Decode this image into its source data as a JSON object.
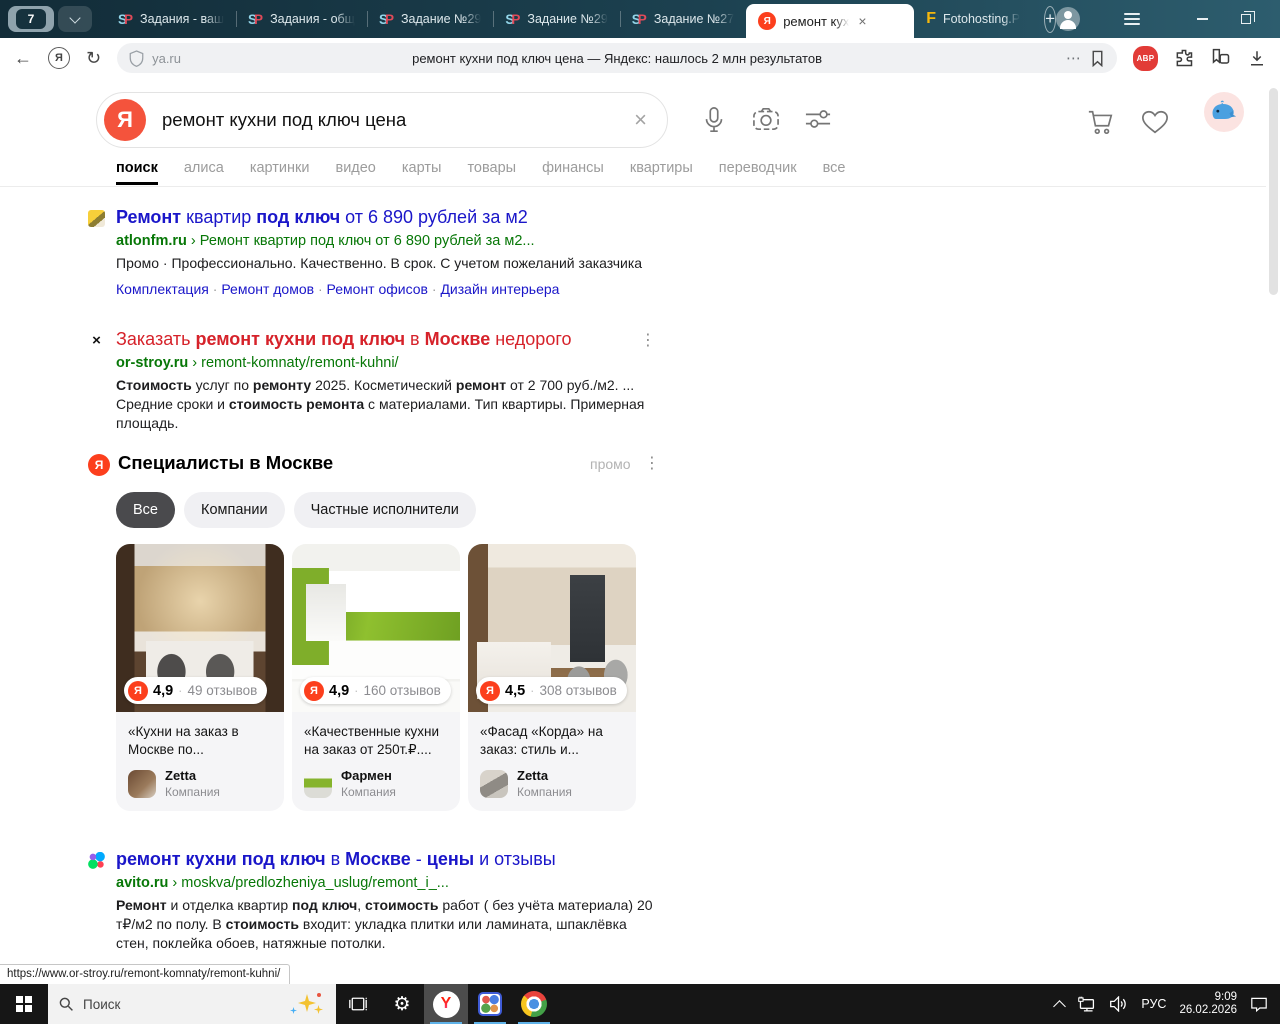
{
  "icons": {
    "close": "×",
    "clear": "×",
    "plus": "+",
    "kebab": "⋮",
    "more": "⋯",
    "back": "←",
    "refresh": "↻",
    "breadcrumb_sep": "›",
    "dot_sep": "·",
    "gear": "⚙",
    "orstroy_favicon": "×"
  },
  "browser": {
    "tab_group": {
      "count": "7"
    },
    "tabs": [
      {
        "label": "Задания - ваш",
        "icon": "sp",
        "active": false
      },
      {
        "label": "Задания - общ",
        "icon": "sp",
        "active": false
      },
      {
        "label": "Задание №29",
        "icon": "sp",
        "active": false
      },
      {
        "label": "Задание №29",
        "icon": "sp",
        "active": false
      },
      {
        "label": "Задание №27",
        "icon": "sp",
        "active": false
      },
      {
        "label": "ремонт кух",
        "icon": "yandex",
        "active": true
      },
      {
        "label": "Fotohosting.P",
        "icon": "fotohosting",
        "active": false
      }
    ],
    "toolbar": {
      "url": "ya.ru",
      "page_title": "ремонт кухни под ключ цена — Яндекс: нашлось 2 млн результатов",
      "adblock_label": "ABP"
    }
  },
  "search": {
    "logo_letter": "Я",
    "query": "ремонт кухни под ключ цена",
    "tabs": [
      {
        "label": "поиск",
        "active": true
      },
      {
        "label": "алиса",
        "active": false
      },
      {
        "label": "картинки",
        "active": false
      },
      {
        "label": "видео",
        "active": false
      },
      {
        "label": "карты",
        "active": false
      },
      {
        "label": "товары",
        "active": false
      },
      {
        "label": "финансы",
        "active": false
      },
      {
        "label": "квартиры",
        "active": false
      },
      {
        "label": "переводчик",
        "active": false
      },
      {
        "label": "все",
        "active": false
      }
    ]
  },
  "results": [
    {
      "favicon": "atlon",
      "title_color": "blue",
      "kebab": false,
      "title": [
        [
          "Ремонт",
          true
        ],
        [
          " квартир ",
          false
        ],
        [
          "под ключ",
          true
        ],
        [
          " от 6 890 рублей за м2",
          false
        ]
      ],
      "domain": "atlonfm.ru",
      "path": "Ремонт квартир под ключ от 6 890 рублей за м2...",
      "snippet": [
        [
          "Промо · Профессионально. Качественно. В срок. С учетом пожеланий заказчика",
          false
        ]
      ],
      "sitelinks": [
        "Комплектация",
        "Ремонт домов",
        "Ремонт офисов",
        "Дизайн интерьера"
      ]
    },
    {
      "favicon": "orstroy",
      "title_color": "red",
      "kebab": true,
      "title": [
        [
          "Заказать ",
          false
        ],
        [
          "ремонт кухни под ключ",
          true
        ],
        [
          " в ",
          false
        ],
        [
          "Москве",
          true
        ],
        [
          " недорого",
          false
        ]
      ],
      "domain": "or-stroy.ru",
      "path": "remont-komnaty/remont-kuhni/",
      "snippet": [
        [
          "Стоимость",
          true
        ],
        [
          " услуг по ",
          false
        ],
        [
          "ремонту",
          true
        ],
        [
          " 2025. Косметический ",
          false
        ],
        [
          "ремонт",
          true
        ],
        [
          " от 2 700 руб./м2. ... Средние сроки и ",
          false
        ],
        [
          "стоимость ремонта",
          true
        ],
        [
          " с материалами. Тип квартиры. Примерная площадь.",
          false
        ]
      ],
      "sitelinks": null
    },
    {
      "favicon": "avito",
      "title_color": "blue",
      "kebab": false,
      "title": [
        [
          "ремонт кухни под ключ",
          true
        ],
        [
          " в ",
          false
        ],
        [
          "Москве",
          true
        ],
        [
          " - ",
          false
        ],
        [
          "цены",
          true
        ],
        [
          " и отзывы",
          false
        ]
      ],
      "domain": "avito.ru",
      "path": "moskva/predlozheniya_uslug/remont_i_...",
      "snippet": [
        [
          "Ремонт",
          true
        ],
        [
          " и отделка квартир ",
          false
        ],
        [
          "под ключ",
          true
        ],
        [
          ", ",
          false
        ],
        [
          "стоимость",
          true
        ],
        [
          " работ ( без учёта материала) 20 т₽/м2 по полу. В ",
          false
        ],
        [
          "стоимость",
          true
        ],
        [
          " входит: укладка плитки или ламината, шпаклёвка стен, поклейка обоев, натяжные потолки.",
          false
        ]
      ],
      "sitelinks": null
    }
  ],
  "specialists": {
    "title": "Специалисты в Москве",
    "promo_label": "промо",
    "filters": [
      {
        "label": "Все",
        "active": true
      },
      {
        "label": "Компании",
        "active": false
      },
      {
        "label": "Частные исполнители",
        "active": false
      }
    ],
    "cards": [
      {
        "rating": "4,9",
        "reviews": "49 отзывов",
        "title": "«Кухни на заказ в Москве по...",
        "company": "Zetta",
        "company_type": "Компания",
        "image": "kitchen-gold"
      },
      {
        "rating": "4,9",
        "reviews": "160 отзывов",
        "title": "«Качественные кухни на заказ от 250т.₽....",
        "company": "Фармен",
        "company_type": "Компания",
        "image": "kitchen-green"
      },
      {
        "rating": "4,5",
        "reviews": "308 отзывов",
        "title": "«Фасад «Корда» на заказ: стиль и...",
        "company": "Zetta",
        "company_type": "Компания",
        "image": "kitchen-beige"
      }
    ]
  },
  "status_bar": {
    "url": "https://www.or-stroy.ru/remont-komnaty/remont-kuhni/"
  },
  "taskbar": {
    "search_label": "Поиск",
    "language": "РУС",
    "time": "9:09",
    "date": "26.02.2026"
  }
}
